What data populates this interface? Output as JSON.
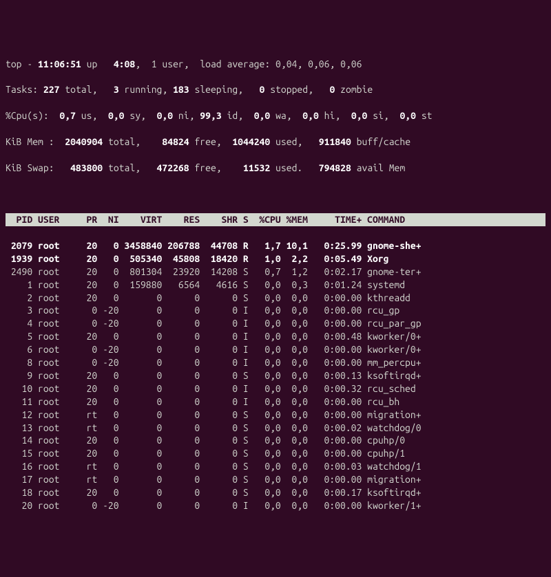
{
  "summary": {
    "line1_prefix": "top - ",
    "time": "11:06:51",
    "up_label": " up ",
    "uptime": "  4:08",
    "users": ",  1 user,  load average: 0,04, 0,06, 0,06",
    "tasks_label": "Tasks: ",
    "tasks_total": "227",
    "tasks_total_l": " total,   ",
    "tasks_running": "3",
    "tasks_running_l": " running, ",
    "tasks_sleeping": "183",
    "tasks_sleeping_l": " sleeping,   ",
    "tasks_stopped": "0",
    "tasks_stopped_l": " stopped,   ",
    "tasks_zombie": "0",
    "tasks_zombie_l": " zombie",
    "cpu_label": "%Cpu(s):  ",
    "cpu_us": "0,7",
    "cpu_us_l": " us,  ",
    "cpu_sy": "0,0",
    "cpu_sy_l": " sy,  ",
    "cpu_ni": "0,0",
    "cpu_ni_l": " ni, ",
    "cpu_id": "99,3",
    "cpu_id_l": " id,  ",
    "cpu_wa": "0,0",
    "cpu_wa_l": " wa,  ",
    "cpu_hi": "0,0",
    "cpu_hi_l": " hi,  ",
    "cpu_si": "0,0",
    "cpu_si_l": " si,  ",
    "cpu_st": "0,0",
    "cpu_st_l": " st",
    "mem_label": "KiB Mem :  ",
    "mem_total": "2040904",
    "mem_total_l": " total,    ",
    "mem_free": "84824",
    "mem_free_l": " free,  ",
    "mem_used": "1044240",
    "mem_used_l": " used,   ",
    "mem_buff": "911840",
    "mem_buff_l": " buff/cache",
    "swap_label": "KiB Swap:   ",
    "swap_total": "483800",
    "swap_total_l": " total,   ",
    "swap_free": "472268",
    "swap_free_l": " free,    ",
    "swap_used": "11532",
    "swap_used_l": " used.   ",
    "swap_avail": "794828",
    "swap_avail_l": " avail Mem"
  },
  "columns": {
    "pid": "PID",
    "user": "USER",
    "pr": "PR",
    "ni": "NI",
    "virt": "VIRT",
    "res": "RES",
    "shr": "SHR",
    "s": "S",
    "cpu": "%CPU",
    "mem": "%MEM",
    "time": "TIME+",
    "cmd": "COMMAND"
  },
  "rows": [
    {
      "pid": "2079",
      "user": "root",
      "pr": "20",
      "ni": "0",
      "virt": "3458840",
      "res": "206788",
      "shr": "44708",
      "s": "R",
      "cpu": "1,7",
      "mem": "10,1",
      "time": "0:25.99",
      "cmd": "gnome-she+",
      "bold": true
    },
    {
      "pid": "1939",
      "user": "root",
      "pr": "20",
      "ni": "0",
      "virt": "505340",
      "res": "45808",
      "shr": "18420",
      "s": "R",
      "cpu": "1,0",
      "mem": "2,2",
      "time": "0:05.49",
      "cmd": "Xorg",
      "bold": true
    },
    {
      "pid": "2490",
      "user": "root",
      "pr": "20",
      "ni": "0",
      "virt": "801304",
      "res": "23920",
      "shr": "14208",
      "s": "S",
      "cpu": "0,7",
      "mem": "1,2",
      "time": "0:02.17",
      "cmd": "gnome-ter+",
      "bold": false
    },
    {
      "pid": "1",
      "user": "root",
      "pr": "20",
      "ni": "0",
      "virt": "159880",
      "res": "6564",
      "shr": "4616",
      "s": "S",
      "cpu": "0,0",
      "mem": "0,3",
      "time": "0:01.24",
      "cmd": "systemd",
      "bold": false
    },
    {
      "pid": "2",
      "user": "root",
      "pr": "20",
      "ni": "0",
      "virt": "0",
      "res": "0",
      "shr": "0",
      "s": "S",
      "cpu": "0,0",
      "mem": "0,0",
      "time": "0:00.00",
      "cmd": "kthreadd",
      "bold": false
    },
    {
      "pid": "3",
      "user": "root",
      "pr": "0",
      "ni": "-20",
      "virt": "0",
      "res": "0",
      "shr": "0",
      "s": "I",
      "cpu": "0,0",
      "mem": "0,0",
      "time": "0:00.00",
      "cmd": "rcu_gp",
      "bold": false
    },
    {
      "pid": "4",
      "user": "root",
      "pr": "0",
      "ni": "-20",
      "virt": "0",
      "res": "0",
      "shr": "0",
      "s": "I",
      "cpu": "0,0",
      "mem": "0,0",
      "time": "0:00.00",
      "cmd": "rcu_par_gp",
      "bold": false
    },
    {
      "pid": "5",
      "user": "root",
      "pr": "20",
      "ni": "0",
      "virt": "0",
      "res": "0",
      "shr": "0",
      "s": "I",
      "cpu": "0,0",
      "mem": "0,0",
      "time": "0:00.48",
      "cmd": "kworker/0+",
      "bold": false
    },
    {
      "pid": "6",
      "user": "root",
      "pr": "0",
      "ni": "-20",
      "virt": "0",
      "res": "0",
      "shr": "0",
      "s": "I",
      "cpu": "0,0",
      "mem": "0,0",
      "time": "0:00.00",
      "cmd": "kworker/0+",
      "bold": false
    },
    {
      "pid": "8",
      "user": "root",
      "pr": "0",
      "ni": "-20",
      "virt": "0",
      "res": "0",
      "shr": "0",
      "s": "I",
      "cpu": "0,0",
      "mem": "0,0",
      "time": "0:00.00",
      "cmd": "mm_percpu+",
      "bold": false
    },
    {
      "pid": "9",
      "user": "root",
      "pr": "20",
      "ni": "0",
      "virt": "0",
      "res": "0",
      "shr": "0",
      "s": "S",
      "cpu": "0,0",
      "mem": "0,0",
      "time": "0:00.13",
      "cmd": "ksoftirqd+",
      "bold": false
    },
    {
      "pid": "10",
      "user": "root",
      "pr": "20",
      "ni": "0",
      "virt": "0",
      "res": "0",
      "shr": "0",
      "s": "I",
      "cpu": "0,0",
      "mem": "0,0",
      "time": "0:00.32",
      "cmd": "rcu_sched",
      "bold": false
    },
    {
      "pid": "11",
      "user": "root",
      "pr": "20",
      "ni": "0",
      "virt": "0",
      "res": "0",
      "shr": "0",
      "s": "I",
      "cpu": "0,0",
      "mem": "0,0",
      "time": "0:00.00",
      "cmd": "rcu_bh",
      "bold": false
    },
    {
      "pid": "12",
      "user": "root",
      "pr": "rt",
      "ni": "0",
      "virt": "0",
      "res": "0",
      "shr": "0",
      "s": "S",
      "cpu": "0,0",
      "mem": "0,0",
      "time": "0:00.00",
      "cmd": "migration+",
      "bold": false
    },
    {
      "pid": "13",
      "user": "root",
      "pr": "rt",
      "ni": "0",
      "virt": "0",
      "res": "0",
      "shr": "0",
      "s": "S",
      "cpu": "0,0",
      "mem": "0,0",
      "time": "0:00.02",
      "cmd": "watchdog/0",
      "bold": false
    },
    {
      "pid": "14",
      "user": "root",
      "pr": "20",
      "ni": "0",
      "virt": "0",
      "res": "0",
      "shr": "0",
      "s": "S",
      "cpu": "0,0",
      "mem": "0,0",
      "time": "0:00.00",
      "cmd": "cpuhp/0",
      "bold": false
    },
    {
      "pid": "15",
      "user": "root",
      "pr": "20",
      "ni": "0",
      "virt": "0",
      "res": "0",
      "shr": "0",
      "s": "S",
      "cpu": "0,0",
      "mem": "0,0",
      "time": "0:00.00",
      "cmd": "cpuhp/1",
      "bold": false
    },
    {
      "pid": "16",
      "user": "root",
      "pr": "rt",
      "ni": "0",
      "virt": "0",
      "res": "0",
      "shr": "0",
      "s": "S",
      "cpu": "0,0",
      "mem": "0,0",
      "time": "0:00.03",
      "cmd": "watchdog/1",
      "bold": false
    },
    {
      "pid": "17",
      "user": "root",
      "pr": "rt",
      "ni": "0",
      "virt": "0",
      "res": "0",
      "shr": "0",
      "s": "S",
      "cpu": "0,0",
      "mem": "0,0",
      "time": "0:00.00",
      "cmd": "migration+",
      "bold": false
    },
    {
      "pid": "18",
      "user": "root",
      "pr": "20",
      "ni": "0",
      "virt": "0",
      "res": "0",
      "shr": "0",
      "s": "S",
      "cpu": "0,0",
      "mem": "0,0",
      "time": "0:00.17",
      "cmd": "ksoftirqd+",
      "bold": false
    },
    {
      "pid": "20",
      "user": "root",
      "pr": "0",
      "ni": "-20",
      "virt": "0",
      "res": "0",
      "shr": "0",
      "s": "I",
      "cpu": "0,0",
      "mem": "0,0",
      "time": "0:00.00",
      "cmd": "kworker/1+",
      "bold": false
    }
  ]
}
